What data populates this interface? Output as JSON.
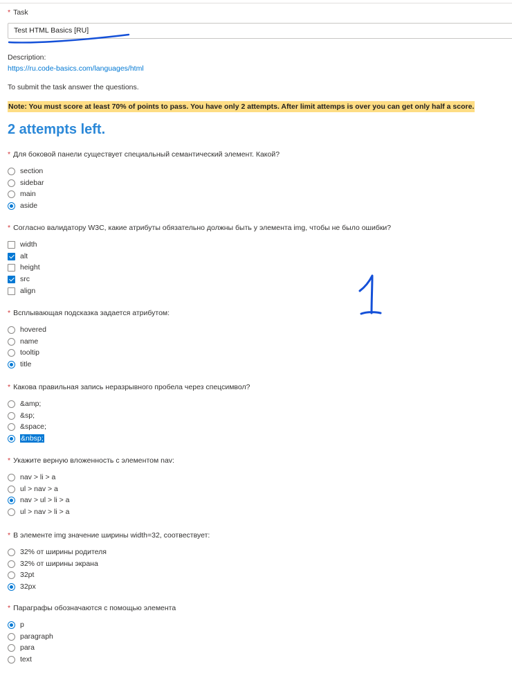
{
  "form": {
    "task_label": "Task",
    "task_value": "Test HTML Basics [RU]",
    "description_label": "Description:",
    "description_link": "https://ru.code-basics.com/languages/html",
    "submit_text": "To submit the task answer the questions.",
    "note": "Note: You must score at least 70% of points to pass. You have only 2 attempts. After limit attemps is over you can get only half a score.",
    "attempts_left": "2 attempts left.",
    "required_mark": "*"
  },
  "colors": {
    "accent": "#0078d4",
    "required": "#d13438",
    "note_background": "#fedd84",
    "attempts_text": "#2b88d8",
    "ink": "#1450d8"
  },
  "questions": [
    {
      "title": "Для боковой панели существует специальный семантический элемент. Какой?",
      "type": "radio",
      "options": [
        {
          "label": "section",
          "selected": false
        },
        {
          "label": "sidebar",
          "selected": false
        },
        {
          "label": "main",
          "selected": false
        },
        {
          "label": "aside",
          "selected": true
        }
      ]
    },
    {
      "title": "Согласно валидатору W3C, какие атрибуты обязательно должны быть у элемента img, чтобы не было ошибки?",
      "type": "checkbox",
      "options": [
        {
          "label": "width",
          "selected": false
        },
        {
          "label": "alt",
          "selected": true
        },
        {
          "label": "height",
          "selected": false
        },
        {
          "label": "src",
          "selected": true
        },
        {
          "label": "align",
          "selected": false
        }
      ]
    },
    {
      "title": "Всплывающая подсказка задается атрибутом:",
      "type": "radio",
      "options": [
        {
          "label": "hovered",
          "selected": false
        },
        {
          "label": "name",
          "selected": false
        },
        {
          "label": "tooltip",
          "selected": false
        },
        {
          "label": "title",
          "selected": true
        }
      ]
    },
    {
      "title": "Какова правильная запись неразрывного пробела через спецсимвол?",
      "type": "radio",
      "options": [
        {
          "label": "&amp;",
          "selected": false
        },
        {
          "label": "&sp;",
          "selected": false
        },
        {
          "label": "&space;",
          "selected": false
        },
        {
          "label": "&nbsp;",
          "selected": true
        }
      ]
    },
    {
      "title": "Укажите верную вложенность с элементом nav:",
      "type": "radio",
      "options": [
        {
          "label": "nav > li > a",
          "selected": false
        },
        {
          "label": "ul > nav > a",
          "selected": false
        },
        {
          "label": "nav > ul > li > a",
          "selected": true
        },
        {
          "label": "ul > nav > li > a",
          "selected": false
        }
      ]
    },
    {
      "title": "В элементе img значение ширины width=32, соотвествует:",
      "type": "radio",
      "options": [
        {
          "label": "32% от ширины родителя",
          "selected": false
        },
        {
          "label": "32% от ширины экрана",
          "selected": false
        },
        {
          "label": "32pt",
          "selected": false
        },
        {
          "label": "32px",
          "selected": true
        }
      ]
    },
    {
      "title": "Параграфы обозначаются с помощью элемента",
      "type": "radio",
      "options": [
        {
          "label": "p",
          "selected": true
        },
        {
          "label": "paragraph",
          "selected": false
        },
        {
          "label": "para",
          "selected": false
        },
        {
          "label": "text",
          "selected": false
        }
      ]
    }
  ]
}
